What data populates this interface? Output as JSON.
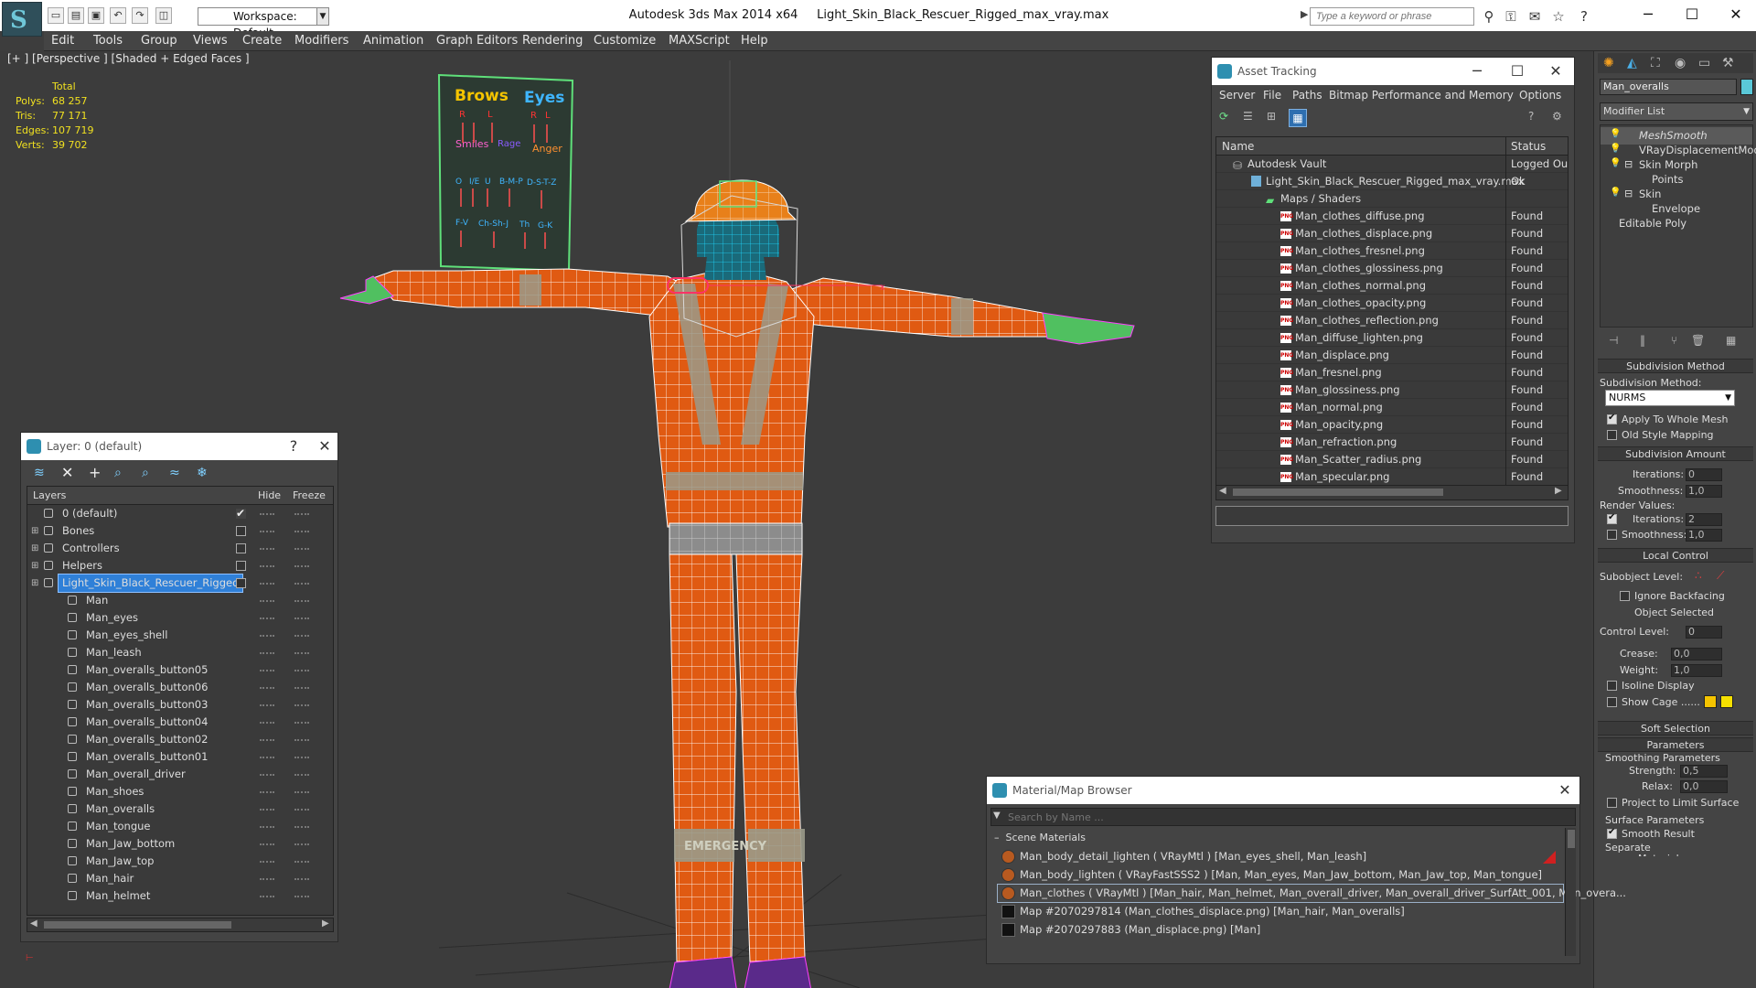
{
  "titlebar": {
    "app": "Autodesk 3ds Max  2014 x64",
    "file": "Light_Skin_Black_Rescuer_Rigged_max_vray.max",
    "workspace": "Workspace: Default",
    "search_placeholder": "Type a keyword or phrase"
  },
  "menu": [
    "Edit",
    "Tools",
    "Group",
    "Views",
    "Create",
    "Modifiers",
    "Animation",
    "Graph Editors",
    "Rendering",
    "Customize",
    "MAXScript",
    "Help"
  ],
  "viewport": {
    "label": "[+ ] [Perspective ] [Shaded + Edged Faces ]",
    "stats": {
      "header": "Total",
      "rows": [
        {
          "label": "Polys:",
          "value": "68 257"
        },
        {
          "label": "Tris:",
          "value": "77 171"
        },
        {
          "label": "Edges:",
          "value": "107 719"
        },
        {
          "label": "Verts:",
          "value": "39 702"
        }
      ]
    },
    "board": {
      "brows": "Brows",
      "eyes": "Eyes",
      "r": "R",
      "l": "L",
      "smiles": "Smiles",
      "rage": "Rage",
      "anger": "Anger",
      "row2": [
        "O",
        "I/E",
        "U",
        "B-M-P",
        "D-S-T-Z"
      ],
      "row3": [
        "F-V",
        "Ch-Sh-J",
        "Th",
        "G-K"
      ]
    },
    "emergency": "EMERGENCY"
  },
  "layer_manager": {
    "title": "Layer: 0 (default)",
    "help": "?",
    "columns": {
      "layers": "Layers",
      "hide": "Hide",
      "freeze": "Freeze"
    },
    "layers": [
      {
        "name": "0 (default)",
        "level": 0,
        "checked": true
      },
      {
        "name": "Bones",
        "level": 0,
        "expand": true
      },
      {
        "name": "Controllers",
        "level": 0,
        "expand": true
      },
      {
        "name": "Helpers",
        "level": 0,
        "expand": true
      },
      {
        "name": "Light_Skin_Black_Rescuer_Rigged",
        "level": 0,
        "expand": true,
        "selected": true
      },
      {
        "name": "Man",
        "level": 1
      },
      {
        "name": "Man_eyes",
        "level": 1
      },
      {
        "name": "Man_eyes_shell",
        "level": 1
      },
      {
        "name": "Man_leash",
        "level": 1
      },
      {
        "name": "Man_overalls_button05",
        "level": 1
      },
      {
        "name": "Man_overalls_button06",
        "level": 1
      },
      {
        "name": "Man_overalls_button03",
        "level": 1
      },
      {
        "name": "Man_overalls_button04",
        "level": 1
      },
      {
        "name": "Man_overalls_button02",
        "level": 1
      },
      {
        "name": "Man_overalls_button01",
        "level": 1
      },
      {
        "name": "Man_overall_driver",
        "level": 1
      },
      {
        "name": "Man_shoes",
        "level": 1
      },
      {
        "name": "Man_overalls",
        "level": 1
      },
      {
        "name": "Man_tongue",
        "level": 1
      },
      {
        "name": "Man_Jaw_bottom",
        "level": 1
      },
      {
        "name": "Man_Jaw_top",
        "level": 1
      },
      {
        "name": "Man_hair",
        "level": 1
      },
      {
        "name": "Man_helmet",
        "level": 1
      }
    ]
  },
  "asset_tracking": {
    "title": "Asset Tracking",
    "menu": [
      "Server",
      "File",
      "Paths",
      "Bitmap Performance and Memory",
      "Options"
    ],
    "columns": {
      "name": "Name",
      "status": "Status"
    },
    "rows": [
      {
        "name": "Autodesk Vault",
        "status": "Logged Out",
        "level": 0,
        "kind": "vault"
      },
      {
        "name": "Light_Skin_Black_Rescuer_Rigged_max_vray.max",
        "status": "Ok",
        "level": 1,
        "kind": "max"
      },
      {
        "name": "Maps / Shaders",
        "status": "",
        "level": 2,
        "kind": "folder"
      },
      {
        "name": "Man_clothes_diffuse.png",
        "status": "Found",
        "level": 3,
        "kind": "png"
      },
      {
        "name": "Man_clothes_displace.png",
        "status": "Found",
        "level": 3,
        "kind": "png"
      },
      {
        "name": "Man_clothes_fresnel.png",
        "status": "Found",
        "level": 3,
        "kind": "png"
      },
      {
        "name": "Man_clothes_glossiness.png",
        "status": "Found",
        "level": 3,
        "kind": "png"
      },
      {
        "name": "Man_clothes_normal.png",
        "status": "Found",
        "level": 3,
        "kind": "png"
      },
      {
        "name": "Man_clothes_opacity.png",
        "status": "Found",
        "level": 3,
        "kind": "png"
      },
      {
        "name": "Man_clothes_reflection.png",
        "status": "Found",
        "level": 3,
        "kind": "png"
      },
      {
        "name": "Man_diffuse_lighten.png",
        "status": "Found",
        "level": 3,
        "kind": "png"
      },
      {
        "name": "Man_displace.png",
        "status": "Found",
        "level": 3,
        "kind": "png"
      },
      {
        "name": "Man_fresnel.png",
        "status": "Found",
        "level": 3,
        "kind": "png"
      },
      {
        "name": "Man_glossiness.png",
        "status": "Found",
        "level": 3,
        "kind": "png"
      },
      {
        "name": "Man_normal.png",
        "status": "Found",
        "level": 3,
        "kind": "png"
      },
      {
        "name": "Man_opacity.png",
        "status": "Found",
        "level": 3,
        "kind": "png"
      },
      {
        "name": "Man_refraction.png",
        "status": "Found",
        "level": 3,
        "kind": "png"
      },
      {
        "name": "Man_Scatter_radius.png",
        "status": "Found",
        "level": 3,
        "kind": "png"
      },
      {
        "name": "Man_specular.png",
        "status": "Found",
        "level": 3,
        "kind": "png"
      }
    ]
  },
  "material_browser": {
    "title": "Material/Map Browser",
    "search_placeholder": "Search by Name ...",
    "group": "Scene Materials",
    "items": [
      "Man_body_detail_lighten  ( VRayMtl ) [Man_eyes_shell, Man_leash]",
      "Man_body_lighten  ( VRayFastSSS2 ) [Man, Man_eyes, Man_Jaw_bottom, Man_Jaw_top, Man_tongue]",
      "Man_clothes  ( VRayMtl ) [Man_hair, Man_helmet, Man_overall_driver, Man_overall_driver_SurfAtt_001, Man_overa...",
      "Map #2070297814 (Man_clothes_displace.png) [Man_hair, Man_overalls]",
      "Map #2070297883 (Man_displace.png) [Man]"
    ]
  },
  "command_panel": {
    "object_name": "Man_overalls",
    "modifier_list": "Modifier List",
    "stack": [
      {
        "name": "MeshSmooth",
        "italic": true
      },
      {
        "name": "VRayDisplacementMod"
      },
      {
        "name": "Skin Morph"
      },
      {
        "name": "Points",
        "sub": true
      },
      {
        "name": "Skin"
      },
      {
        "name": "Envelope",
        "sub": true
      },
      {
        "name": "Editable Poly"
      }
    ],
    "subdiv_method": {
      "title": "Subdivision Method",
      "label": "Subdivision Method:",
      "value": "NURMS",
      "apply": "Apply To Whole Mesh",
      "old": "Old Style Mapping"
    },
    "subdiv_amount": {
      "title": "Subdivision Amount",
      "iterations_label": "Iterations:",
      "iterations": "0",
      "smoothness_label": "Smoothness:",
      "smoothness": "1,0",
      "render_values": "Render Values:",
      "r_iterations_label": "Iterations:",
      "r_iterations": "2",
      "r_smoothness_label": "Smoothness:",
      "r_smoothness": "1,0"
    },
    "local_control": {
      "title": "Local Control",
      "subobject": "Subobject Level:",
      "ignore": "Ignore Backfacing",
      "selected": "Object Selected",
      "control_level": "Control Level:",
      "control_value": "0",
      "crease_label": "Crease:",
      "crease": "0,0",
      "weight_label": "Weight:",
      "weight": "1,0",
      "isoline": "Isoline Display",
      "show_cage": "Show Cage ......"
    },
    "soft_selection": "Soft Selection",
    "parameters": {
      "title": "Parameters",
      "smoothing": "Smoothing Parameters",
      "strength_label": "Strength:",
      "strength": "0,5",
      "relax_label": "Relax:",
      "relax": "0,0",
      "project": "Project to Limit Surface",
      "surface": "Surface Parameters",
      "smooth_result": "Smooth Result",
      "separate": "Separate",
      "materials": "Materials"
    },
    "colors": {
      "cage1": "#f5c400",
      "cage2": "#f5e000"
    }
  }
}
